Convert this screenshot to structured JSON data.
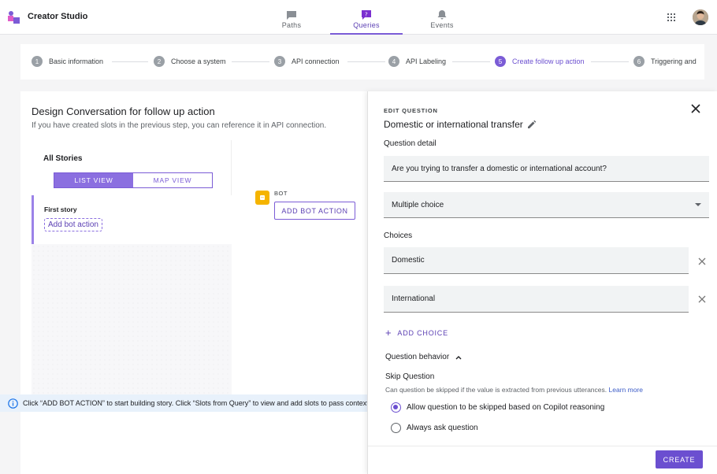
{
  "app": {
    "title": "Creator Studio"
  },
  "nav": {
    "tabs": [
      {
        "label": "Paths",
        "icon": "chat-icon",
        "active": false
      },
      {
        "label": "Queries",
        "icon": "question-icon",
        "active": true
      },
      {
        "label": "Events",
        "icon": "bell-icon",
        "active": false
      }
    ]
  },
  "stepper": {
    "steps": [
      {
        "num": "1",
        "label": "Basic information"
      },
      {
        "num": "2",
        "label": "Choose a system"
      },
      {
        "num": "3",
        "label": "API connection"
      },
      {
        "num": "4",
        "label": "API Labeling"
      },
      {
        "num": "5",
        "label": "Create follow up action"
      },
      {
        "num": "6",
        "label": "Triggering and"
      }
    ],
    "active_step": "5"
  },
  "main": {
    "title": "Design Conversation for follow up action",
    "subtitle": "If you have created slots in the previous step, you can reference it in API connection.",
    "stories_title": "All Stories",
    "list_view": "LIST VIEW",
    "map_view": "MAP VIEW",
    "story_name": "First story",
    "add_bot_link": "Add bot action",
    "bot_label": "BOT",
    "add_bot_button": "ADD BOT ACTION",
    "info_text": "Click “ADD BOT ACTION” to start building story. Click “Slots from Query” to view and add slots to pass context"
  },
  "panel": {
    "header_label": "EDIT QUESTION",
    "question_title": "Domestic or international transfer",
    "detail_label": "Question detail",
    "detail_value": "Are you trying to transfer a domestic or international account?",
    "type_value": "Multiple choice",
    "choices_label": "Choices",
    "choices": [
      "Domestic",
      "International"
    ],
    "add_choice": "ADD CHOICE",
    "behavior_label": "Question behavior",
    "skip_title": "Skip Question",
    "skip_desc": "Can question be skipped if the value is extracted from previous utterances.",
    "learn_more": "Learn more",
    "radio_options": [
      {
        "label": "Allow question to be skipped based on Copilot reasoning",
        "selected": true
      },
      {
        "label": "Always ask question",
        "selected": false
      }
    ],
    "create_button": "CREATE"
  },
  "colors": {
    "accent": "#6b4fd0",
    "bot_badge": "#f5b400",
    "info_bg": "#e8f1fb"
  }
}
